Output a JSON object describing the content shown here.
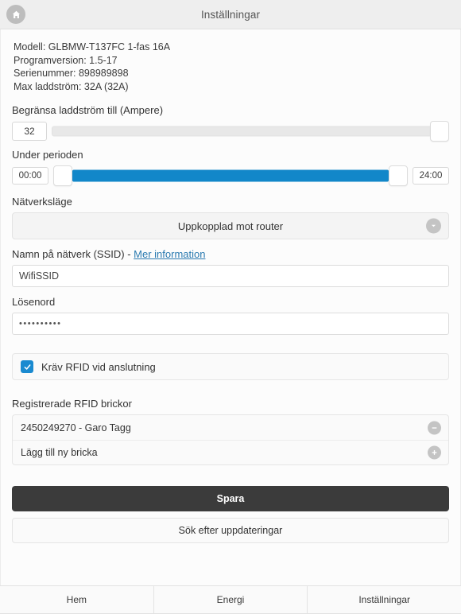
{
  "header": {
    "title": "Inställningar",
    "home_icon": "home-icon"
  },
  "device_info": {
    "model": "Modell: GLBMW-T137FC 1-fas 16A",
    "firmware": "Programversion: 1.5-17",
    "serial": "Serienummer: 898989898",
    "max_current": "Max laddström: 32A (32A)"
  },
  "current_limit": {
    "label": "Begränsa laddström till (Ampere)",
    "value": "32",
    "min": 0,
    "max": 32,
    "handle_percent": 100,
    "track_color": "#e8e8e8"
  },
  "period": {
    "label": "Under perioden",
    "start_value": "00:00",
    "end_value": "24:00",
    "fill_start_percent": 0,
    "fill_end_percent": 100,
    "fill_color": "#1287c9"
  },
  "network_mode": {
    "label": "Nätverksläge",
    "selected": "Uppkopplad mot router",
    "options": [
      "Uppkopplad mot router"
    ],
    "chevron_icon": "chevron-down-icon"
  },
  "ssid": {
    "label_prefix": "Namn på nätverk (SSID) - ",
    "link_text": "Mer information",
    "link_color": "#2a7ab0",
    "value": "WifiSSID",
    "placeholder": "WifiSSID"
  },
  "password": {
    "label": "Lösenord",
    "value": "••••••••••",
    "placeholder": ""
  },
  "rfid_required": {
    "label": "Kräv RFID vid anslutning",
    "checked": true,
    "accent_color": "#1a8ad0"
  },
  "rfid_list": {
    "label": "Registrerade RFID brickor",
    "items": [
      {
        "text": "2450249270 - Garo Tagg",
        "action_icon": "minus-circle-icon"
      },
      {
        "text": "Lägg till ny bricka",
        "action_icon": "plus-circle-icon"
      }
    ]
  },
  "actions": {
    "save_label": "Spara",
    "save_color": "#3b3b3b",
    "update_label": "Sök efter uppdateringar"
  },
  "tabbar": {
    "tabs": [
      {
        "label": "Hem"
      },
      {
        "label": "Energi"
      },
      {
        "label": "Inställningar"
      }
    ]
  }
}
